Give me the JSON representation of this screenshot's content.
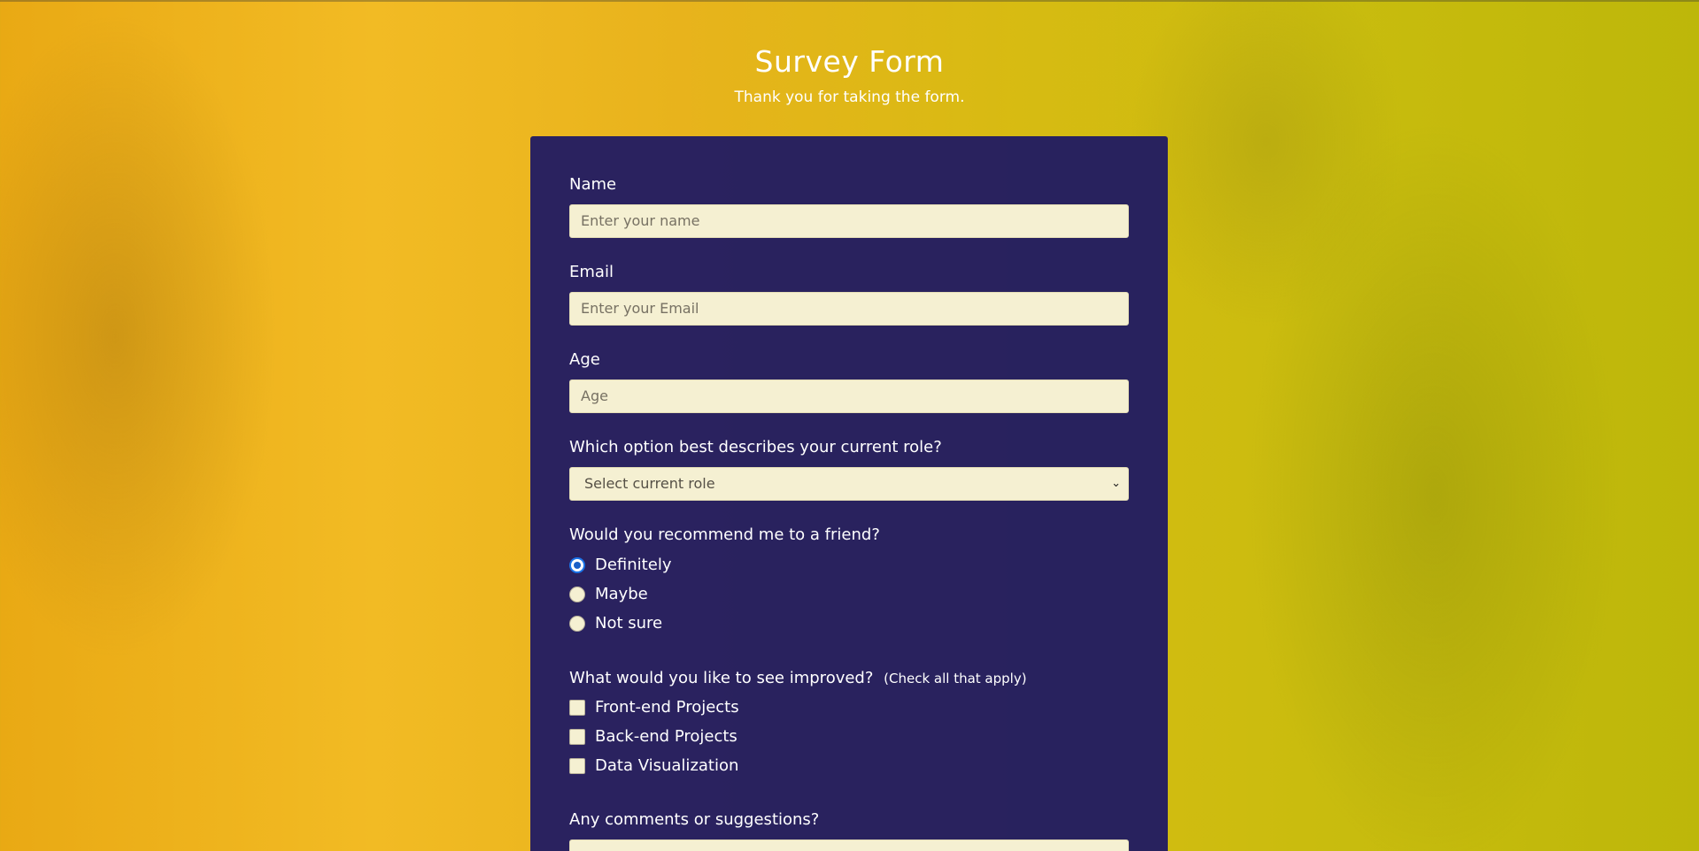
{
  "header": {
    "title": "Survey Form",
    "subtitle": "Thank you for taking the form."
  },
  "form": {
    "name": {
      "label": "Name",
      "placeholder": "Enter your name",
      "value": ""
    },
    "email": {
      "label": "Email",
      "placeholder": "Enter your Email",
      "value": ""
    },
    "age": {
      "label": "Age",
      "placeholder": "Age",
      "value": ""
    },
    "role": {
      "label": "Which option best describes your current role?",
      "selected": "Select current role"
    },
    "recommend": {
      "label": "Would you recommend me to a friend?",
      "options": [
        {
          "label": "Definitely",
          "checked": true
        },
        {
          "label": "Maybe",
          "checked": false
        },
        {
          "label": "Not sure",
          "checked": false
        }
      ]
    },
    "improve": {
      "label": "What would you like to see improved?",
      "hint": "(Check all that apply)",
      "options": [
        {
          "label": "Front-end Projects",
          "checked": false
        },
        {
          "label": "Back-end Projects",
          "checked": false
        },
        {
          "label": "Data Visualization",
          "checked": false
        }
      ]
    },
    "comments": {
      "label": "Any comments or suggestions?"
    }
  },
  "colors": {
    "card_background": "#1b1764",
    "input_background": "#f5f0d2",
    "page_background_left": "#e9a914",
    "page_background_right": "#bdb70a",
    "radio_selected": "#1a73e8"
  }
}
